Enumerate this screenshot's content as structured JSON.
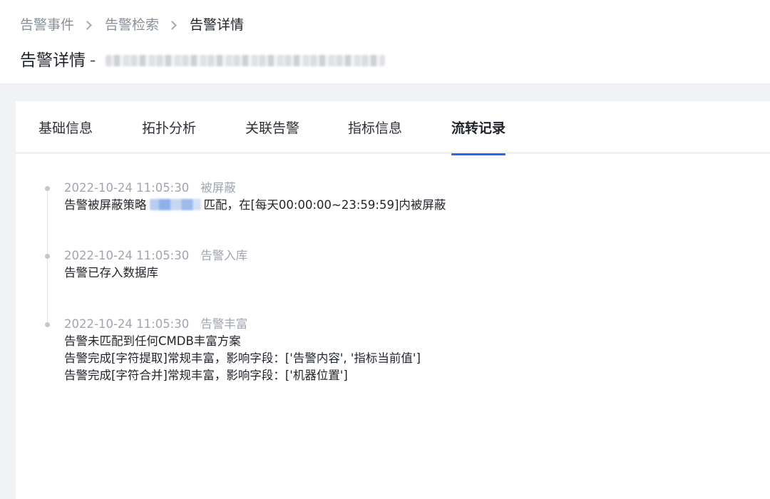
{
  "breadcrumb": {
    "items": [
      "告警事件",
      "告警检索",
      "告警详情"
    ]
  },
  "page_title": {
    "label": "告警详情",
    "separator": "-"
  },
  "tabs": [
    {
      "label": "基础信息",
      "active": false
    },
    {
      "label": "拓扑分析",
      "active": false
    },
    {
      "label": "关联告警",
      "active": false
    },
    {
      "label": "指标信息",
      "active": false
    },
    {
      "label": "流转记录",
      "active": true
    }
  ],
  "timeline": [
    {
      "time": "2022-10-24 11:05:30",
      "status": "被屏蔽",
      "lines": [
        "告警被屏蔽策略",
        "匹配，在[每天00:00:00~23:59:59]内被屏蔽"
      ]
    },
    {
      "time": "2022-10-24 11:05:30",
      "status": "告警入库",
      "lines": [
        "告警已存入数据库"
      ]
    },
    {
      "time": "2022-10-24 11:05:30",
      "status": "告警丰富",
      "lines": [
        "告警未匹配到任何CMDB丰富方案",
        "告警完成[字符提取]常规丰富，影响字段：['告警内容', '指标当前值']",
        "告警完成[字符合并]常规丰富，影响字段：['机器位置']"
      ]
    }
  ],
  "colors": {
    "accent": "#2468f2",
    "muted_text": "#a0a5ad",
    "primary_text": "#1f2329",
    "page_bg": "#f1f2f5"
  }
}
